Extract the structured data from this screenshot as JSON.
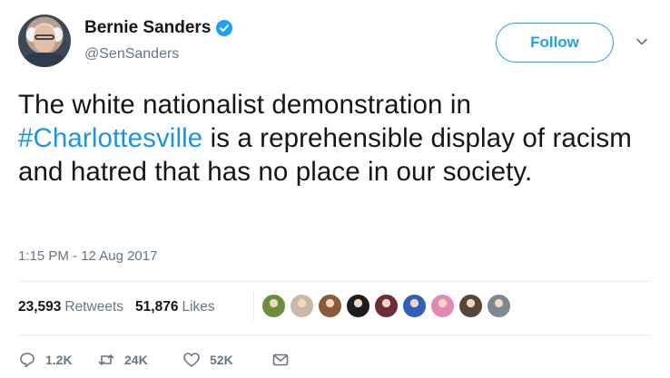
{
  "author": {
    "display_name": "Bernie Sanders",
    "handle": "@SenSanders",
    "verified": true
  },
  "follow_button": {
    "label": "Follow"
  },
  "tweet": {
    "text_before": "The white nationalist demonstration in ",
    "hashtag": "#Charlottesville",
    "text_after": " is a reprehensible display of racism and hatred that has no place in our society.",
    "timestamp": "1:15 PM - 12 Aug 2017"
  },
  "stats": {
    "retweets_count": "23,593",
    "retweets_label": "Retweets",
    "likes_count": "51,876",
    "likes_label": "Likes"
  },
  "likers": [
    {
      "icon": "liker-avatar",
      "color": "#6a8f3c"
    },
    {
      "icon": "liker-avatar",
      "color": "#c9b9a7"
    },
    {
      "icon": "liker-avatar",
      "color": "#8b5a3c"
    },
    {
      "icon": "liker-avatar",
      "color": "#1d1d1d"
    },
    {
      "icon": "liker-avatar",
      "color": "#6b2f3a"
    },
    {
      "icon": "liker-avatar",
      "color": "#2f5fb8"
    },
    {
      "icon": "liker-avatar",
      "color": "#e48ab0"
    },
    {
      "icon": "liker-avatar",
      "color": "#5a4638"
    },
    {
      "icon": "liker-avatar",
      "color": "#7b8a8c"
    }
  ],
  "actions": {
    "reply_count": "1.2K",
    "retweet_count": "24K",
    "like_count": "52K"
  },
  "colors": {
    "accent": "#1da1f2",
    "hashtag": "#1b95e0",
    "muted": "#657786"
  }
}
